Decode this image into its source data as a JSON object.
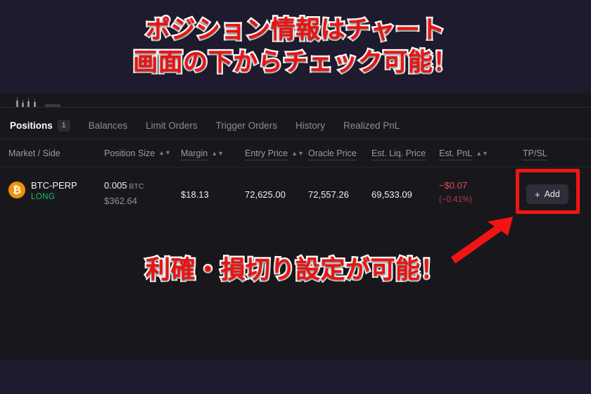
{
  "annotations": {
    "top_line1": "ポジション情報はチャート",
    "top_line2": "画面の下からチェック可能！",
    "bottom_line": "利確・損切り設定が可能！",
    "highlight_color": "#f21414",
    "arrow_color": "#f21414",
    "text_color": "#ee1111",
    "text_outline_color": "#ffffff"
  },
  "panel": {
    "background": "#18181c",
    "tabs": [
      {
        "label": "Positions",
        "badge": "1",
        "active": true
      },
      {
        "label": "Balances",
        "badge": "",
        "active": false
      },
      {
        "label": "Limit Orders",
        "badge": "",
        "active": false
      },
      {
        "label": "Trigger Orders",
        "badge": "",
        "active": false
      },
      {
        "label": "History",
        "badge": "",
        "active": false
      },
      {
        "label": "Realized PnL",
        "badge": "",
        "active": false
      }
    ],
    "columns": [
      {
        "label": "Market / Side",
        "sortable": false,
        "tooltip": false
      },
      {
        "label": "Position Size",
        "sortable": true,
        "tooltip": false
      },
      {
        "label": "Margin",
        "sortable": true,
        "tooltip": true
      },
      {
        "label": "Entry Price",
        "sortable": true,
        "tooltip": true
      },
      {
        "label": "Oracle Price",
        "sortable": false,
        "tooltip": true
      },
      {
        "label": "Est. Liq. Price",
        "sortable": false,
        "tooltip": true
      },
      {
        "label": "Est. PnL",
        "sortable": true,
        "tooltip": true
      },
      {
        "label": "TP/SL",
        "sortable": false,
        "tooltip": true
      }
    ],
    "rows": [
      {
        "coin_glyph": "₿",
        "coin_color": "#f0910a",
        "market": "BTC-PERP",
        "side": "LONG",
        "side_color": "#1fbf75",
        "size_base": "0.005",
        "size_unit": "BTC",
        "size_quote": "$362.64",
        "margin": "$18.13",
        "entry_price": "72,625.00",
        "oracle_price": "72,557.26",
        "liq_price": "69,533.09",
        "pnl_value": "−$0.07",
        "pnl_pct": "(−0.41%)",
        "pnl_color": "#e8495a",
        "tpsl_button": "Add",
        "tpsl_plus": "+"
      }
    ]
  }
}
